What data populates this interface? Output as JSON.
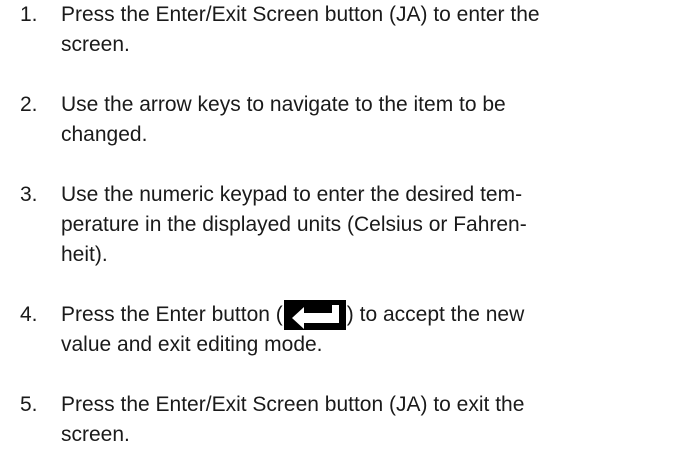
{
  "steps": [
    {
      "number": "1.",
      "lines": [
        "Press the Enter/Exit Screen button (JA) to enter the",
        "screen."
      ]
    },
    {
      "number": "2.",
      "lines": [
        "Use the arrow keys to navigate to the item to be",
        "changed."
      ]
    },
    {
      "number": "3.",
      "lines": [
        "Use the numeric keypad to enter the desired tem-",
        "perature in the displayed units (Celsius or Fahren-",
        "heit)."
      ]
    },
    {
      "number": "4.",
      "line1_before": "Press the Enter button (",
      "line1_after": ") to accept the new",
      "line2": "value and exit editing mode.",
      "icon": "enter-key-icon"
    },
    {
      "number": "5.",
      "lines": [
        "Press the Enter/Exit Screen button (JA) to exit the",
        "screen."
      ]
    }
  ]
}
